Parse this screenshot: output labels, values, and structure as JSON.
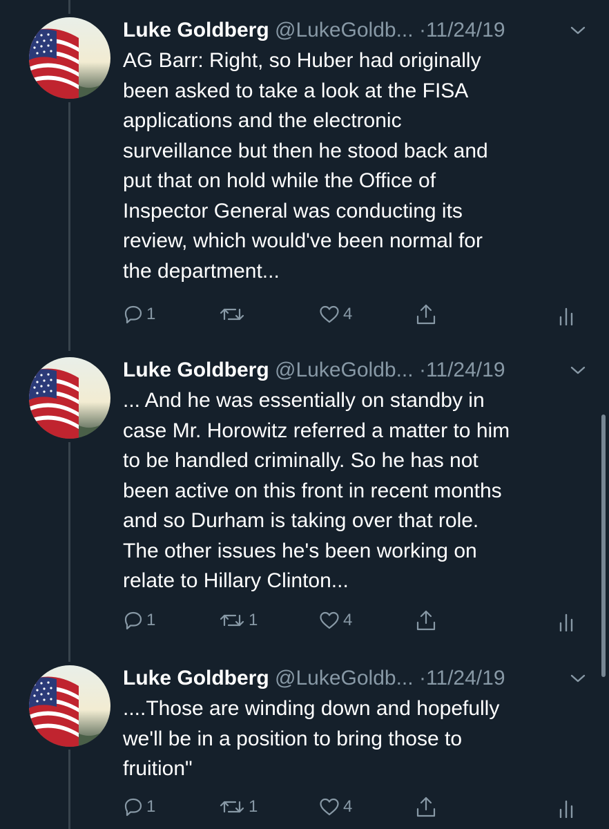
{
  "colors": {
    "background": "#15202b",
    "text_primary": "#ffffff",
    "text_secondary": "#8899a6",
    "thread_line": "#38444d"
  },
  "tweets": [
    {
      "name": "Luke Goldberg",
      "handle": "@LukeGoldb...",
      "separator": "·",
      "date": "11/24/19",
      "text": "AG Barr: Right, so Huber had originally\nbeen asked to take a look at the FISA\napplications and the electronic\nsurveillance but then he stood back and\nput that on hold while the Office of\nInspector General was conducting its\nreview, which would've been normal for\nthe department...",
      "replies": "1",
      "retweets": "",
      "likes": "4"
    },
    {
      "name": "Luke Goldberg",
      "handle": "@LukeGoldb...",
      "separator": "·",
      "date": "11/24/19",
      "text": "... And he was essentially on standby in\ncase Mr. Horowitz referred a matter to him\nto be handled criminally. So he has not\nbeen active on this front in recent months\nand so Durham is taking over that role.\nThe other issues he's been working on\nrelate to Hillary Clinton...",
      "replies": "1",
      "retweets": "1",
      "likes": "4"
    },
    {
      "name": "Luke Goldberg",
      "handle": "@LukeGoldb...",
      "separator": "·",
      "date": "11/24/19",
      "text": "....Those are winding down and hopefully\nwe'll be in a position to bring those to\nfruition\"",
      "replies": "1",
      "retweets": "1",
      "likes": "4"
    }
  ],
  "icons": {
    "avatar": "american-flag",
    "menu": "chevron-down-icon",
    "reply": "reply-icon",
    "retweet": "retweet-icon",
    "like": "heart-icon",
    "share": "share-icon",
    "analytics": "analytics-icon"
  }
}
